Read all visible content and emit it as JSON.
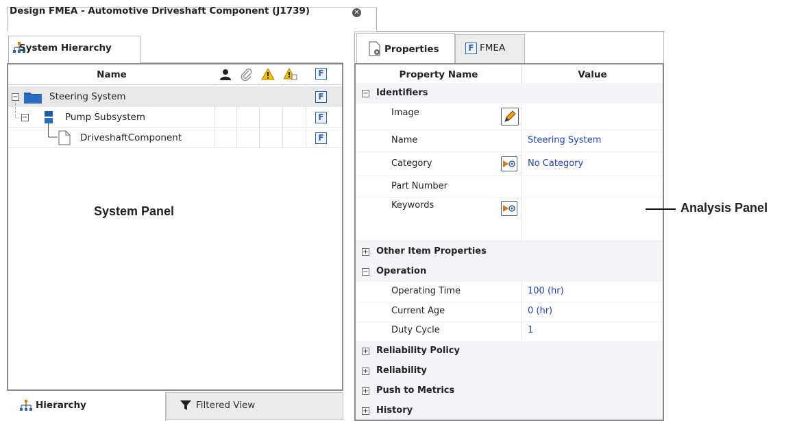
{
  "document": {
    "title": "Design FMEA - Automotive Driveshaft Component (J1739)"
  },
  "system_panel": {
    "tab_label": "System Hierarchy",
    "name_header": "Name",
    "header_icons": [
      "person-icon",
      "paperclip-icon",
      "warning-icon",
      "warning-doc-icon",
      "fmea-f-icon"
    ],
    "tree": [
      {
        "label": "Steering System",
        "icon": "folder-icon",
        "expander": "−"
      },
      {
        "label": "Pump Subsystem",
        "icon": "subsystem-icon",
        "expander": "−"
      },
      {
        "label": "DriveshaftComponent",
        "icon": "document-icon"
      }
    ],
    "f_glyph": "F",
    "bottom_tabs": {
      "hierarchy": "Hierarchy",
      "filtered": "Filtered View"
    }
  },
  "analysis_panel": {
    "tabs": {
      "properties": "Properties",
      "fmea": "FMEA",
      "fmea_glyph": "F"
    },
    "headers": {
      "property_name": "Property Name",
      "value": "Value"
    },
    "sections": {
      "identifiers": "Identifiers",
      "other": "Other Item Properties",
      "operation": "Operation",
      "reliability_policy": "Reliability Policy",
      "reliability": "Reliability",
      "push_metrics": "Push to Metrics",
      "history": "History"
    },
    "props": {
      "image": "Image",
      "name": "Name",
      "name_value": "Steering System",
      "category": "Category",
      "category_value": "No Category",
      "part_number": "Part Number",
      "keywords": "Keywords",
      "operating_time": "Operating Time",
      "operating_time_value": "100 (hr)",
      "current_age": "Current Age",
      "current_age_value": "0 (hr)",
      "duty_cycle": "Duty Cycle",
      "duty_cycle_value": "1"
    },
    "expander_minus": "−",
    "expander_plus": "+"
  },
  "callouts": {
    "system_panel": "System Panel",
    "analysis_panel": "Analysis Panel"
  },
  "colors": {
    "link_blue": "#1a3fc7",
    "f_icon_blue": "#2c64b8",
    "folder_blue": "#1f5aa8"
  }
}
